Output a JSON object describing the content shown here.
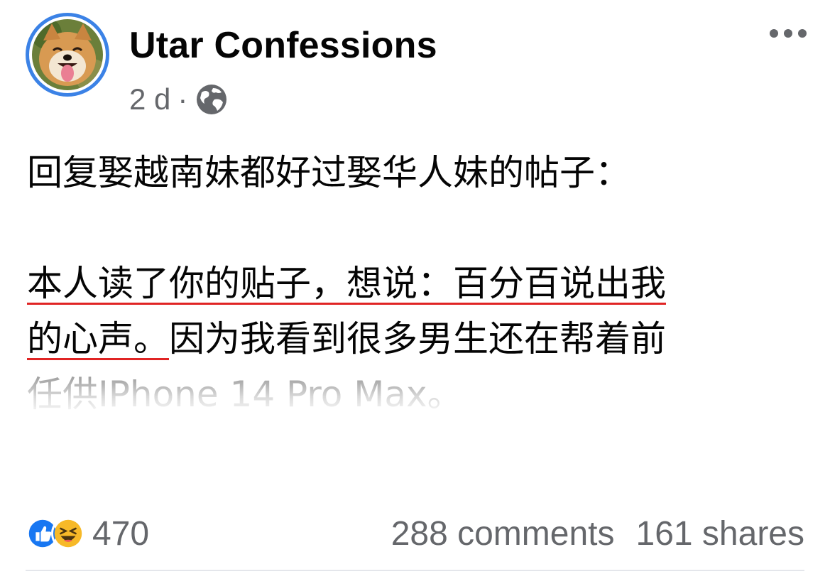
{
  "post": {
    "author": "Utar Confessions",
    "time": "2 d",
    "separator": "·",
    "audience_icon": "globe-icon",
    "avatar_icon": "shiba-dog-avatar",
    "body": {
      "line1": "回复娶越南妹都好过娶华人妹的帖子：",
      "line2": "本人读了你的贴子，想说：百分百说出我",
      "line3_underlined": "的心声。",
      "line3_rest": "因为我看到很多男生还在帮着前",
      "line4_faded": "任供IPhone 14 Pro Max。"
    },
    "underline_color": "#e02424"
  },
  "footer": {
    "reaction_count": "470",
    "comments": "288 comments",
    "shares": "161 shares",
    "reaction_icons": [
      "like-icon",
      "haha-icon"
    ]
  },
  "colors": {
    "like_blue": "#1877f2",
    "avatar_ring": "#3b82e6",
    "secondary_text": "#65676b"
  }
}
